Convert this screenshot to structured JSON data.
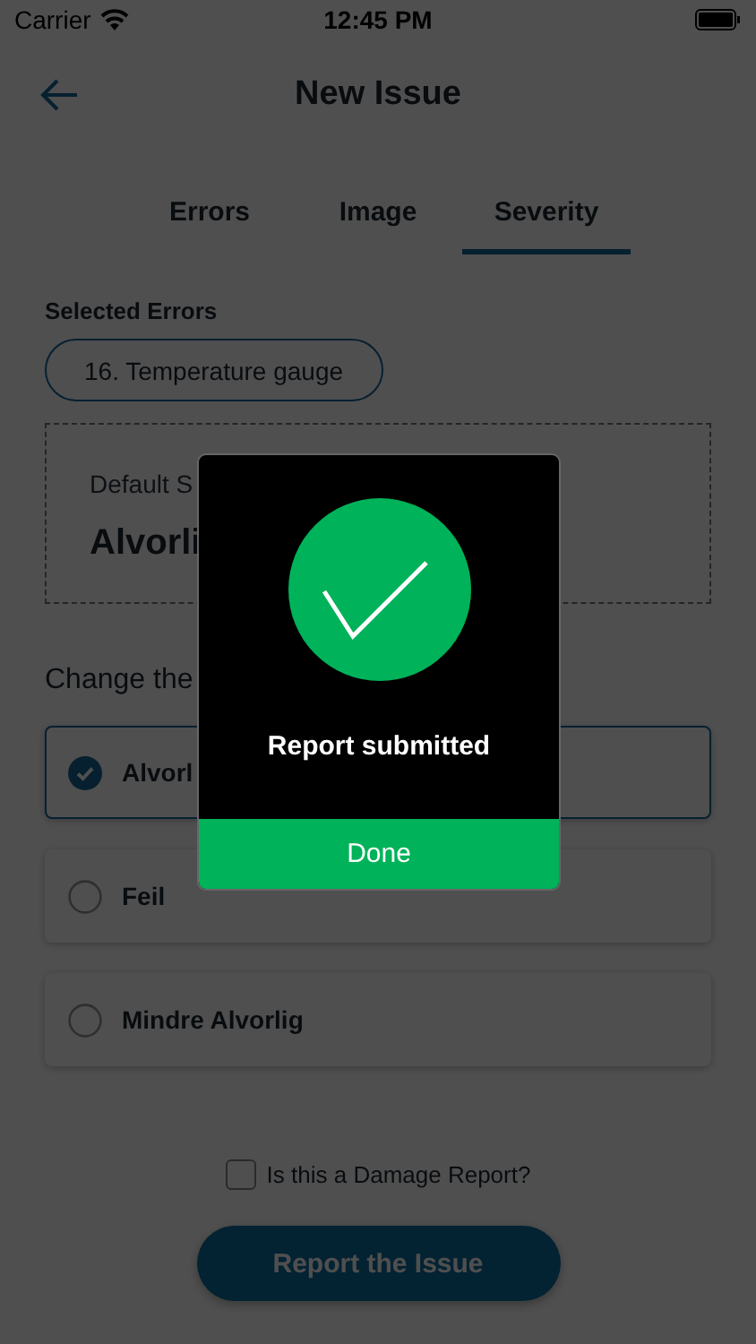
{
  "status_bar": {
    "carrier": "Carrier",
    "time": "12:45 PM"
  },
  "header": {
    "title": "New Issue"
  },
  "tabs": [
    {
      "label": "Errors",
      "selected": false
    },
    {
      "label": "Image",
      "selected": false
    },
    {
      "label": "Severity",
      "selected": true
    }
  ],
  "selected_errors": {
    "label": "Selected Errors",
    "chips": [
      "16. Temperature gauge"
    ]
  },
  "default_severity": {
    "label": "Default S",
    "value": "Alvorli"
  },
  "change_label": "Change the",
  "options": [
    {
      "label": "Alvorl",
      "selected": true
    },
    {
      "label": "Feil",
      "selected": false
    },
    {
      "label": "Mindre Alvorlig",
      "selected": false
    }
  ],
  "damage_report": {
    "label": "Is this a Damage Report?",
    "checked": false
  },
  "report_button": {
    "label": "Report the Issue"
  },
  "modal": {
    "message": "Report submitted",
    "button": "Done"
  }
}
